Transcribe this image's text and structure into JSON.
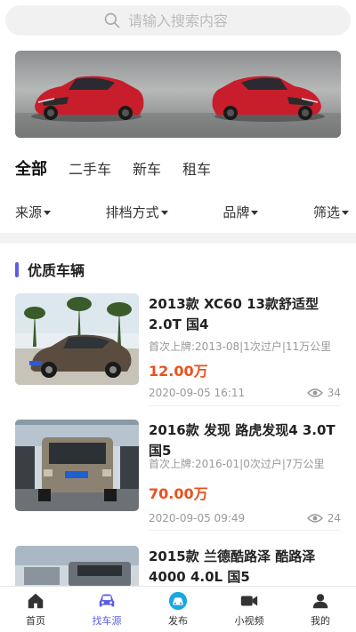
{
  "search": {
    "placeholder": "请输入搜索内容"
  },
  "categories": [
    {
      "label": "全部",
      "active": true
    },
    {
      "label": "二手车",
      "active": false
    },
    {
      "label": "新车",
      "active": false
    },
    {
      "label": "租车",
      "active": false
    }
  ],
  "filters": [
    {
      "label": "来源"
    },
    {
      "label": "排档方式"
    },
    {
      "label": "品牌"
    },
    {
      "label": "筛选"
    }
  ],
  "section": {
    "title": "优质车辆"
  },
  "cars": [
    {
      "title": "2013款 XC60 13款舒适型 2.0T 国4",
      "meta": "首次上牌:2013-08|1次过户|11万公里",
      "price": "12.00万",
      "date": "2020-09-05 16:11",
      "views": "34"
    },
    {
      "title": "2016款 发现 路虎发现4 3.0T 国5",
      "meta": "首次上牌:2016-01|0次过户|7万公里",
      "price": "70.00万",
      "date": "2020-09-05 09:49",
      "views": "24"
    },
    {
      "title": "2015款 兰德酷路泽 酷路泽4000 4.0L 国5",
      "meta": "",
      "price": "",
      "date": "",
      "views": ""
    }
  ],
  "tabbar": [
    {
      "label": "首页",
      "icon": "home-icon",
      "active": false
    },
    {
      "label": "找车源",
      "icon": "car-icon",
      "active": true
    },
    {
      "label": "发布",
      "icon": "publish-icon",
      "active": false
    },
    {
      "label": "小视频",
      "icon": "video-icon",
      "active": false
    },
    {
      "label": "我的",
      "icon": "user-icon",
      "active": false
    }
  ],
  "colors": {
    "accent": "#5b5de8",
    "price": "#e8521d",
    "muted": "#999999"
  }
}
